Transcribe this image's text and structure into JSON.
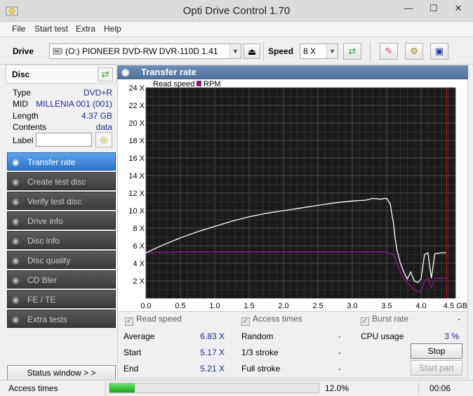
{
  "window": {
    "title": "Opti Drive Control 1.70",
    "minimize": "—",
    "maximize": "☐",
    "close": "✕"
  },
  "menu": [
    "File",
    "Start test",
    "Extra",
    "Help"
  ],
  "drivebar": {
    "drive_label": "Drive",
    "drive_value": "(O:)  PIONEER DVD-RW  DVR-110D 1.41",
    "speed_label": "Speed",
    "speed_value": "8 X"
  },
  "disc": {
    "title": "Disc",
    "rows": [
      {
        "label": "Type",
        "value": "DVD+R"
      },
      {
        "label": "MID",
        "value": "MILLENIA 001 (001)"
      },
      {
        "label": "Length",
        "value": "4.37 GB"
      },
      {
        "label": "Contents",
        "value": "data"
      }
    ],
    "label_field": "Label"
  },
  "nav": [
    "Transfer rate",
    "Create test disc",
    "Verify test disc",
    "Drive info",
    "Disc info",
    "Disc quality",
    "CD Bler",
    "FE / TE",
    "Extra tests"
  ],
  "nav_active": 0,
  "status_window_button": "Status window > >",
  "panel": {
    "title": "Transfer rate"
  },
  "chart_data": {
    "type": "line",
    "legend": [
      "Read speed",
      "RPM"
    ],
    "x_ticks": [
      "0.0",
      "0.5",
      "1.0",
      "1.5",
      "2.0",
      "2.5",
      "3.0",
      "3.5",
      "4.0",
      "4.5 GB"
    ],
    "y_ticks": [
      "2 X",
      "4 X",
      "6 X",
      "8 X",
      "10 X",
      "12 X",
      "14 X",
      "16 X",
      "18 X",
      "20 X",
      "22 X",
      "24 X"
    ],
    "xlim": [
      0,
      4.5
    ],
    "ylim": [
      0,
      24
    ],
    "marker_x": 4.37,
    "colors": {
      "read_speed": "#ffffff",
      "rpm": "#8b1a8b",
      "marker": "#cc1111",
      "background": "#1a1a1a",
      "grid": "#4a4a4a"
    },
    "series": [
      {
        "name": "Read speed",
        "x": [
          0.0,
          0.25,
          0.5,
          0.75,
          1.0,
          1.25,
          1.5,
          1.75,
          2.0,
          2.25,
          2.5,
          2.75,
          3.0,
          3.2,
          3.3,
          3.4,
          3.5,
          3.55,
          3.6,
          3.62,
          3.65,
          3.7,
          3.75,
          3.8,
          3.85,
          3.9,
          3.95,
          4.0,
          4.05,
          4.1,
          4.15,
          4.2,
          4.3,
          4.37
        ],
        "y": [
          5.2,
          6.1,
          6.9,
          7.6,
          8.2,
          8.8,
          9.3,
          9.7,
          10.0,
          10.3,
          10.6,
          10.9,
          11.1,
          11.2,
          11.4,
          11.3,
          11.4,
          10.8,
          8.5,
          7.0,
          5.5,
          4.0,
          3.0,
          2.2,
          3.0,
          2.0,
          1.8,
          2.2,
          5.0,
          5.2,
          2.3,
          5.1,
          5.2,
          5.2
        ]
      },
      {
        "name": "RPM",
        "x": [
          0.0,
          0.5,
          1.0,
          1.5,
          2.0,
          2.5,
          3.0,
          3.3,
          3.5,
          3.6,
          3.65,
          3.7,
          3.75,
          3.8,
          3.85,
          3.9,
          3.95,
          4.0,
          4.05,
          4.1,
          4.15,
          4.2,
          4.3,
          4.37
        ],
        "y": [
          5.2,
          5.3,
          5.3,
          5.3,
          5.3,
          5.3,
          5.3,
          5.3,
          5.3,
          5.0,
          4.0,
          3.0,
          2.3,
          1.8,
          1.4,
          1.0,
          0.8,
          0.7,
          2.0,
          2.3,
          1.2,
          2.3,
          2.3,
          2.3
        ]
      }
    ]
  },
  "checks": {
    "read_speed": "Read speed",
    "access_times": "Access times",
    "burst_rate": "Burst rate"
  },
  "stats": {
    "average_label": "Average",
    "average_value": "6.83 X",
    "start_label": "Start",
    "start_value": "5.17 X",
    "end_label": "End",
    "end_value": "5.21 X",
    "random_label": "Random",
    "random_value": "-",
    "stroke13_label": "1/3 stroke",
    "stroke13_value": "-",
    "full_label": "Full stroke",
    "full_value": "-",
    "burst_value": "-",
    "cpu_label": "CPU usage",
    "cpu_value": "3 %",
    "stop_button": "Stop",
    "start_part_button": "Start part"
  },
  "statusbar": {
    "text": "Access times",
    "progress_fraction": 0.12,
    "progress_text": "12.0%",
    "time": "00:06"
  }
}
